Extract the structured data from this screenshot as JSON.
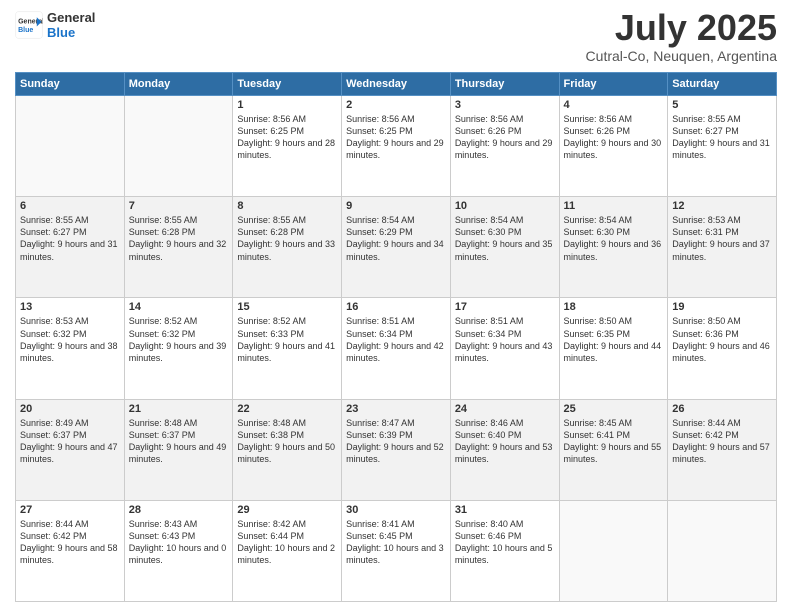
{
  "header": {
    "logo_general": "General",
    "logo_blue": "Blue",
    "month": "July 2025",
    "location": "Cutral-Co, Neuquen, Argentina"
  },
  "days_of_week": [
    "Sunday",
    "Monday",
    "Tuesday",
    "Wednesday",
    "Thursday",
    "Friday",
    "Saturday"
  ],
  "weeks": [
    [
      {
        "day": "",
        "info": ""
      },
      {
        "day": "",
        "info": ""
      },
      {
        "day": "1",
        "info": "Sunrise: 8:56 AM\nSunset: 6:25 PM\nDaylight: 9 hours and 28 minutes."
      },
      {
        "day": "2",
        "info": "Sunrise: 8:56 AM\nSunset: 6:25 PM\nDaylight: 9 hours and 29 minutes."
      },
      {
        "day": "3",
        "info": "Sunrise: 8:56 AM\nSunset: 6:26 PM\nDaylight: 9 hours and 29 minutes."
      },
      {
        "day": "4",
        "info": "Sunrise: 8:56 AM\nSunset: 6:26 PM\nDaylight: 9 hours and 30 minutes."
      },
      {
        "day": "5",
        "info": "Sunrise: 8:55 AM\nSunset: 6:27 PM\nDaylight: 9 hours and 31 minutes."
      }
    ],
    [
      {
        "day": "6",
        "info": "Sunrise: 8:55 AM\nSunset: 6:27 PM\nDaylight: 9 hours and 31 minutes."
      },
      {
        "day": "7",
        "info": "Sunrise: 8:55 AM\nSunset: 6:28 PM\nDaylight: 9 hours and 32 minutes."
      },
      {
        "day": "8",
        "info": "Sunrise: 8:55 AM\nSunset: 6:28 PM\nDaylight: 9 hours and 33 minutes."
      },
      {
        "day": "9",
        "info": "Sunrise: 8:54 AM\nSunset: 6:29 PM\nDaylight: 9 hours and 34 minutes."
      },
      {
        "day": "10",
        "info": "Sunrise: 8:54 AM\nSunset: 6:30 PM\nDaylight: 9 hours and 35 minutes."
      },
      {
        "day": "11",
        "info": "Sunrise: 8:54 AM\nSunset: 6:30 PM\nDaylight: 9 hours and 36 minutes."
      },
      {
        "day": "12",
        "info": "Sunrise: 8:53 AM\nSunset: 6:31 PM\nDaylight: 9 hours and 37 minutes."
      }
    ],
    [
      {
        "day": "13",
        "info": "Sunrise: 8:53 AM\nSunset: 6:32 PM\nDaylight: 9 hours and 38 minutes."
      },
      {
        "day": "14",
        "info": "Sunrise: 8:52 AM\nSunset: 6:32 PM\nDaylight: 9 hours and 39 minutes."
      },
      {
        "day": "15",
        "info": "Sunrise: 8:52 AM\nSunset: 6:33 PM\nDaylight: 9 hours and 41 minutes."
      },
      {
        "day": "16",
        "info": "Sunrise: 8:51 AM\nSunset: 6:34 PM\nDaylight: 9 hours and 42 minutes."
      },
      {
        "day": "17",
        "info": "Sunrise: 8:51 AM\nSunset: 6:34 PM\nDaylight: 9 hours and 43 minutes."
      },
      {
        "day": "18",
        "info": "Sunrise: 8:50 AM\nSunset: 6:35 PM\nDaylight: 9 hours and 44 minutes."
      },
      {
        "day": "19",
        "info": "Sunrise: 8:50 AM\nSunset: 6:36 PM\nDaylight: 9 hours and 46 minutes."
      }
    ],
    [
      {
        "day": "20",
        "info": "Sunrise: 8:49 AM\nSunset: 6:37 PM\nDaylight: 9 hours and 47 minutes."
      },
      {
        "day": "21",
        "info": "Sunrise: 8:48 AM\nSunset: 6:37 PM\nDaylight: 9 hours and 49 minutes."
      },
      {
        "day": "22",
        "info": "Sunrise: 8:48 AM\nSunset: 6:38 PM\nDaylight: 9 hours and 50 minutes."
      },
      {
        "day": "23",
        "info": "Sunrise: 8:47 AM\nSunset: 6:39 PM\nDaylight: 9 hours and 52 minutes."
      },
      {
        "day": "24",
        "info": "Sunrise: 8:46 AM\nSunset: 6:40 PM\nDaylight: 9 hours and 53 minutes."
      },
      {
        "day": "25",
        "info": "Sunrise: 8:45 AM\nSunset: 6:41 PM\nDaylight: 9 hours and 55 minutes."
      },
      {
        "day": "26",
        "info": "Sunrise: 8:44 AM\nSunset: 6:42 PM\nDaylight: 9 hours and 57 minutes."
      }
    ],
    [
      {
        "day": "27",
        "info": "Sunrise: 8:44 AM\nSunset: 6:42 PM\nDaylight: 9 hours and 58 minutes."
      },
      {
        "day": "28",
        "info": "Sunrise: 8:43 AM\nSunset: 6:43 PM\nDaylight: 10 hours and 0 minutes."
      },
      {
        "day": "29",
        "info": "Sunrise: 8:42 AM\nSunset: 6:44 PM\nDaylight: 10 hours and 2 minutes."
      },
      {
        "day": "30",
        "info": "Sunrise: 8:41 AM\nSunset: 6:45 PM\nDaylight: 10 hours and 3 minutes."
      },
      {
        "day": "31",
        "info": "Sunrise: 8:40 AM\nSunset: 6:46 PM\nDaylight: 10 hours and 5 minutes."
      },
      {
        "day": "",
        "info": ""
      },
      {
        "day": "",
        "info": ""
      }
    ]
  ]
}
